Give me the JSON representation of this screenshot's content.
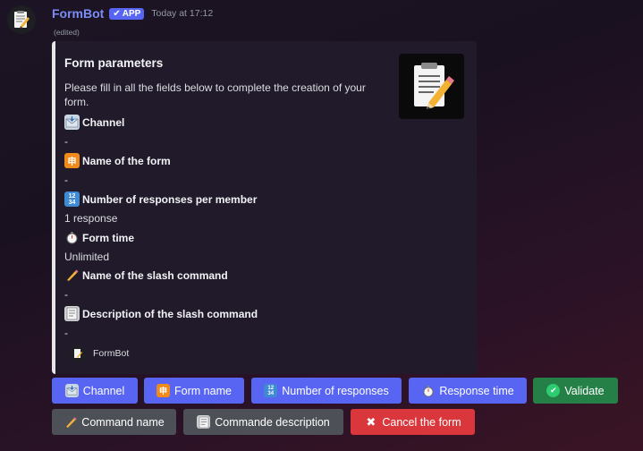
{
  "message": {
    "author": "FormBot",
    "badge": "APP",
    "timestamp": "Today at 17:12",
    "edited": "(edited)"
  },
  "embed": {
    "title": "Form parameters",
    "description": "Please fill in all the fields below to complete the creation of your form.",
    "fields": [
      {
        "name": "Channel",
        "value": "-",
        "icon": "envelope-icon"
      },
      {
        "name": "Name of the form",
        "value": "-",
        "icon": "name-badge-icon"
      },
      {
        "name": "Number of responses per member",
        "value": "1 response",
        "icon": "numbers-icon"
      },
      {
        "name": "Form time",
        "value": "Unlimited",
        "icon": "stopwatch-icon"
      },
      {
        "name": "Name of the slash command",
        "value": "-",
        "icon": "pencil-icon"
      },
      {
        "name": "Description of the slash command",
        "value": "-",
        "icon": "page-icon"
      }
    ],
    "footer": "FormBot",
    "accent_color": "#e6e6e6"
  },
  "buttons": {
    "row1": [
      {
        "label": "Channel",
        "style": "primary",
        "icon": "envelope-icon"
      },
      {
        "label": "Form name",
        "style": "primary",
        "icon": "name-badge-icon"
      },
      {
        "label": "Number of responses",
        "style": "primary",
        "icon": "numbers-icon"
      },
      {
        "label": "Response time",
        "style": "primary",
        "icon": "stopwatch-icon"
      },
      {
        "label": "Validate",
        "style": "success",
        "icon": "check-icon"
      }
    ],
    "row2": [
      {
        "label": "Command name",
        "style": "secondary",
        "icon": "pencil-icon"
      },
      {
        "label": "Commande description",
        "style": "secondary",
        "icon": "page-icon"
      },
      {
        "label": "Cancel the form",
        "style": "danger",
        "icon": "cross-icon"
      }
    ]
  },
  "colors": {
    "primary": "#5865f2",
    "secondary": "#4e5058",
    "success": "#248046",
    "danger": "#da373c",
    "author": "#7c8cf5"
  }
}
